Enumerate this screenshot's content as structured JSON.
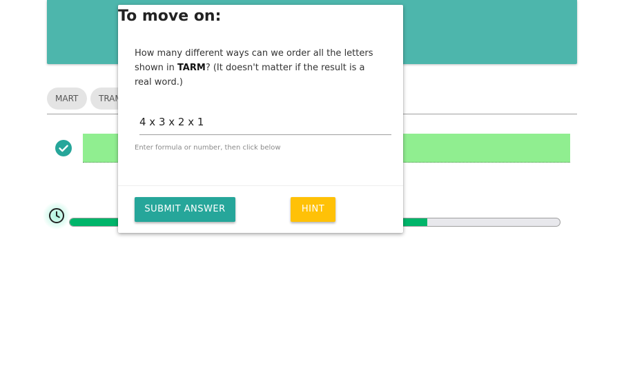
{
  "chips": [
    "MART",
    "TRAM"
  ],
  "progress": {
    "fraction": 0.73
  },
  "colors": {
    "banner": "#4db6ac",
    "answer_bar": "#90ee90",
    "check": "#26a69a",
    "progress_fill": "#00b56a",
    "submit_button": "#26a69a",
    "hint_button": "#ffc107"
  },
  "icons": {
    "check": "check-circle-icon",
    "clock": "clock-icon"
  },
  "modal": {
    "title": "To move on:",
    "question_prefix": " How many different ways can we order all the letters shown in ",
    "question_word": "TARM",
    "question_suffix": "? (It doesn't matter if the result is a real word.)",
    "answer_value": "4 x 3 x 2 x 1",
    "helper_text": "Enter formula or number, then click below",
    "submit_label": "SUBMIT ANSWER",
    "hint_label": "HINT"
  }
}
